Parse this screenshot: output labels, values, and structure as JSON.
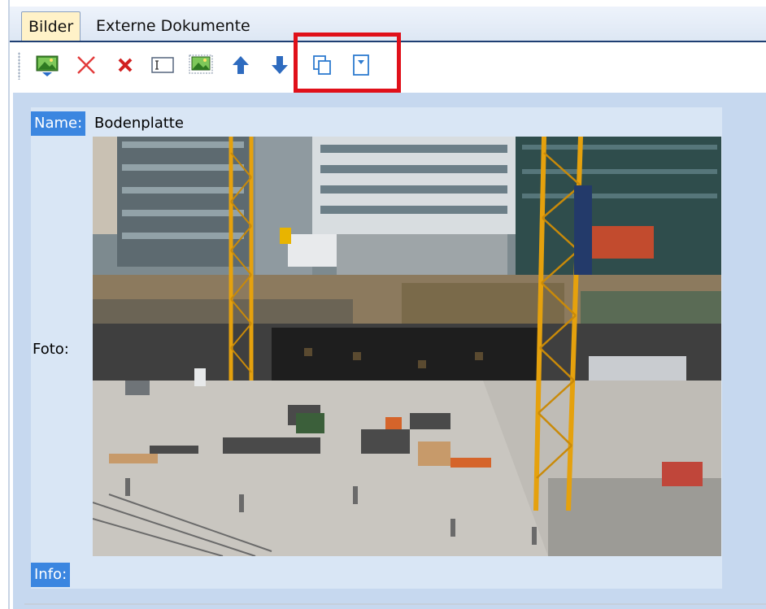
{
  "tabs": [
    {
      "label": "Bilder",
      "active": true
    },
    {
      "label": "Externe Dokumente",
      "active": false
    }
  ],
  "toolbar": {
    "tools": [
      "add-image-icon",
      "delete-icon",
      "remove-icon",
      "text-field-icon",
      "image-frame-icon",
      "arrow-up-icon",
      "arrow-down-icon",
      "copy-icon",
      "dropdown-icon"
    ],
    "highlight_color": "#e0101a"
  },
  "record": {
    "name_label": "Name:",
    "name_value": "Bodenplatte",
    "foto_label": "Foto:",
    "info_label": "Info:",
    "info_value": ""
  },
  "colors": {
    "panel_bg": "#c6d8ef",
    "card_bg": "#d9e6f5",
    "label_highlight": "#3b86e0",
    "active_tab": "#fff2c8",
    "tab_border": "#1f3f73"
  }
}
